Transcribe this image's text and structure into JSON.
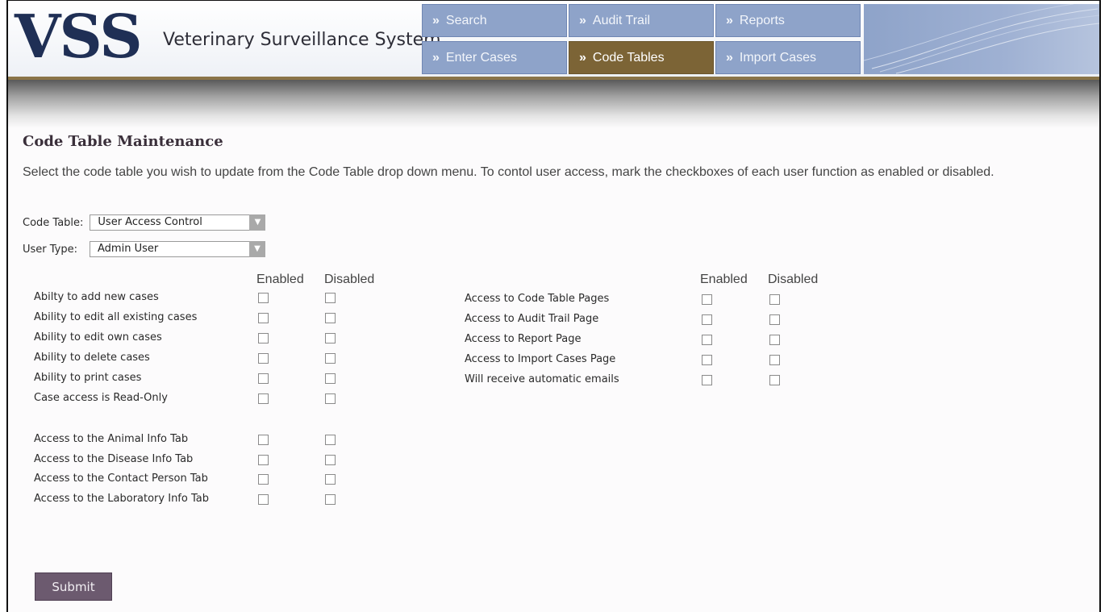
{
  "header": {
    "logo": "VSS",
    "tagline": "Veterinary Surveillance System"
  },
  "nav": [
    {
      "label": "Search",
      "active": false
    },
    {
      "label": "Audit Trail",
      "active": false
    },
    {
      "label": "Reports",
      "active": false
    },
    {
      "label": "Enter Cases",
      "active": false
    },
    {
      "label": "Code Tables",
      "active": true
    },
    {
      "label": "Import Cases",
      "active": false
    }
  ],
  "page": {
    "title": "Code Table Maintenance",
    "description": "Select the code table you wish to update from the Code Table drop down menu.  To contol user access, mark the checkboxes of each user function as enabled or disabled."
  },
  "form": {
    "code_table_label": "Code Table:",
    "code_table_value": "User Access Control",
    "user_type_label": "User Type:",
    "user_type_value": "Admin User"
  },
  "columns": {
    "enabled": "Enabled",
    "disabled": "Disabled"
  },
  "left_functions": [
    {
      "label": "Abilty to add new cases",
      "enabled": false,
      "disabled": false
    },
    {
      "label": "Ability to edit all existing cases",
      "enabled": false,
      "disabled": false
    },
    {
      "label": "Ability to edit own cases",
      "enabled": false,
      "disabled": false
    },
    {
      "label": "Ability to delete cases",
      "enabled": false,
      "disabled": false
    },
    {
      "label": "Ability to print cases",
      "enabled": false,
      "disabled": false
    },
    {
      "label": "Case access is Read-Only",
      "enabled": false,
      "disabled": false
    },
    {
      "label": "Access to the Animal Info Tab",
      "enabled": false,
      "disabled": false
    },
    {
      "label": "Access to the Disease Info Tab",
      "enabled": false,
      "disabled": false
    },
    {
      "label": "Access to the Contact Person Tab",
      "enabled": false,
      "disabled": false
    },
    {
      "label": "Access to the Laboratory Info Tab",
      "enabled": false,
      "disabled": false
    }
  ],
  "right_functions": [
    {
      "label": "Access to Code Table Pages",
      "enabled": false,
      "disabled": false
    },
    {
      "label": "Access to Audit Trail Page",
      "enabled": false,
      "disabled": false
    },
    {
      "label": "Access to Report Page",
      "enabled": false,
      "disabled": false
    },
    {
      "label": "Access to Import Cases Page",
      "enabled": false,
      "disabled": false
    },
    {
      "label": "Will receive automatic emails",
      "enabled": false,
      "disabled": false
    }
  ],
  "submit_label": "Submit"
}
